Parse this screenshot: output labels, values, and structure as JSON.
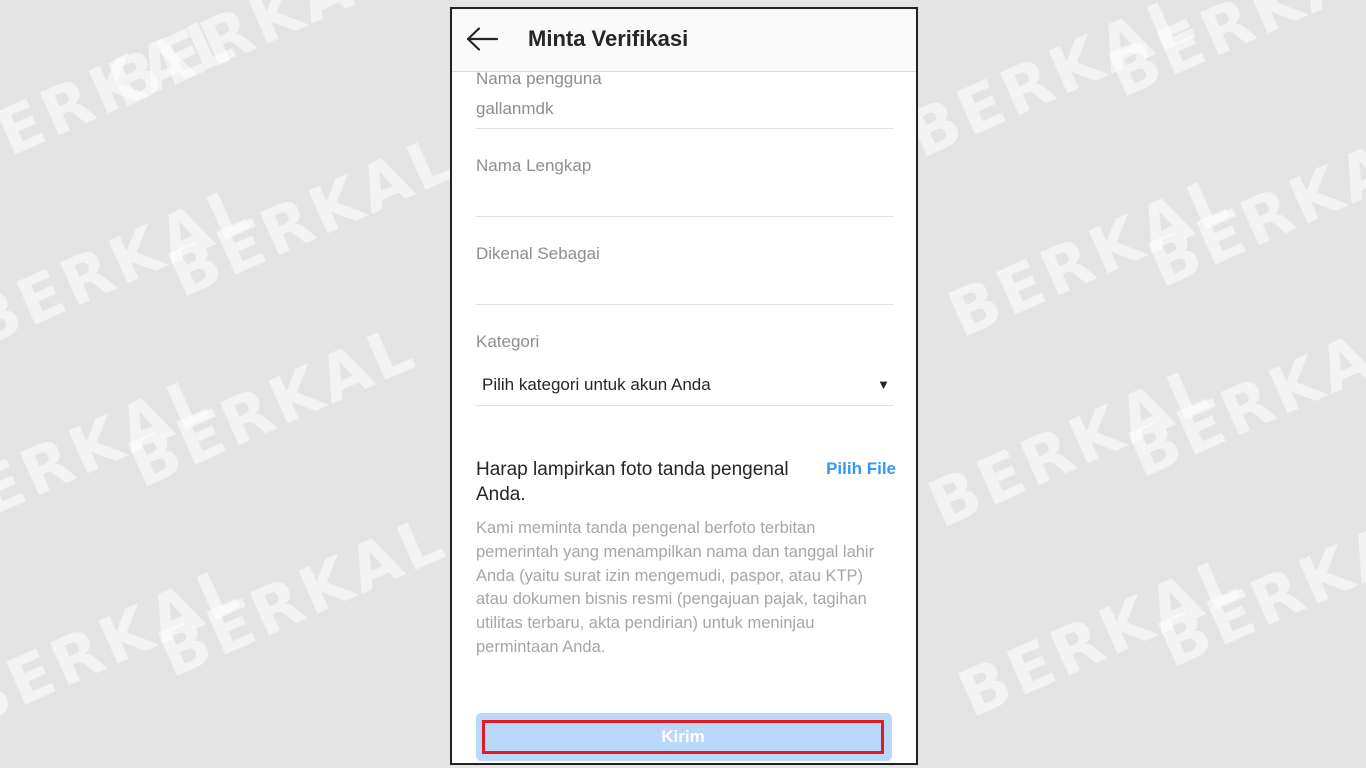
{
  "watermark": {
    "text": "BERKAL",
    "positions": []
  },
  "header": {
    "back_icon": "arrow-left-icon",
    "title": "Minta Verifikasi"
  },
  "form": {
    "username": {
      "label": "Nama pengguna",
      "value": "gallanmdk"
    },
    "full_name": {
      "label": "Nama Lengkap",
      "value": ""
    },
    "known_as": {
      "label": "Dikenal Sebagai",
      "value": ""
    },
    "category": {
      "label": "Kategori",
      "selected": "Pilih kategori untuk akun Anda",
      "caret_icon": "triangle-down-icon"
    },
    "attachment": {
      "prompt": "Harap lampirkan foto tanda pengenal Anda.",
      "pick_file_label": "Pilih File",
      "description": "Kami meminta tanda pengenal berfoto terbitan pemerintah yang menampilkan nama dan tanggal lahir Anda (yaitu surat izin mengemudi, paspor, atau KTP) atau dokumen bisnis resmi (pengajuan pajak, tagihan utilitas terbaru, akta pendirian) untuk meninjau permintaan Anda."
    },
    "submit_label": "Kirim"
  },
  "colors": {
    "accent": "#3897f0",
    "submit_bg": "#b9d8fa",
    "highlight_border": "#e01b24"
  }
}
